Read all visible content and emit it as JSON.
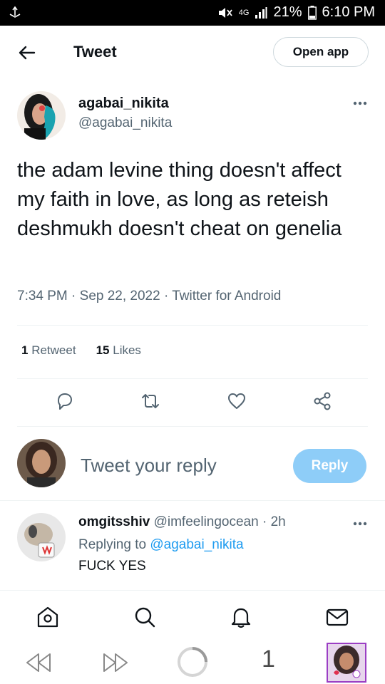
{
  "status_bar": {
    "network": "4G",
    "battery": "21%",
    "time": "6:10 PM"
  },
  "header": {
    "title": "Tweet",
    "open_app_label": "Open app"
  },
  "tweet": {
    "author_name": "agabai_nikita",
    "author_handle": "@agabai_nikita",
    "text": "the adam levine thing doesn't affect my faith in love, as long as reteish deshmukh doesn't cheat on genelia",
    "meta": "7:34 PM · Sep 22, 2022 · Twitter for Android",
    "retweet_count": "1",
    "retweet_label": "Retweet",
    "like_count": "15",
    "like_label": "Likes"
  },
  "reply_box": {
    "placeholder": "Tweet your reply",
    "button_label": "Reply"
  },
  "reply": {
    "name": "omgitsshiv",
    "handle": "@imfeelingocean",
    "age": "· 2h",
    "replying_prefix": "Replying to",
    "replying_to": "@agabai_nikita",
    "text": "FUCK YES"
  },
  "bottom_nav": [
    "home-icon",
    "search-icon",
    "notifications-icon",
    "messages-icon"
  ],
  "system_nav": {
    "page_number": "1"
  },
  "colors": {
    "accent": "#1d9bf0",
    "reply_button": "#8ecdf8",
    "secondary_text": "#536471"
  }
}
